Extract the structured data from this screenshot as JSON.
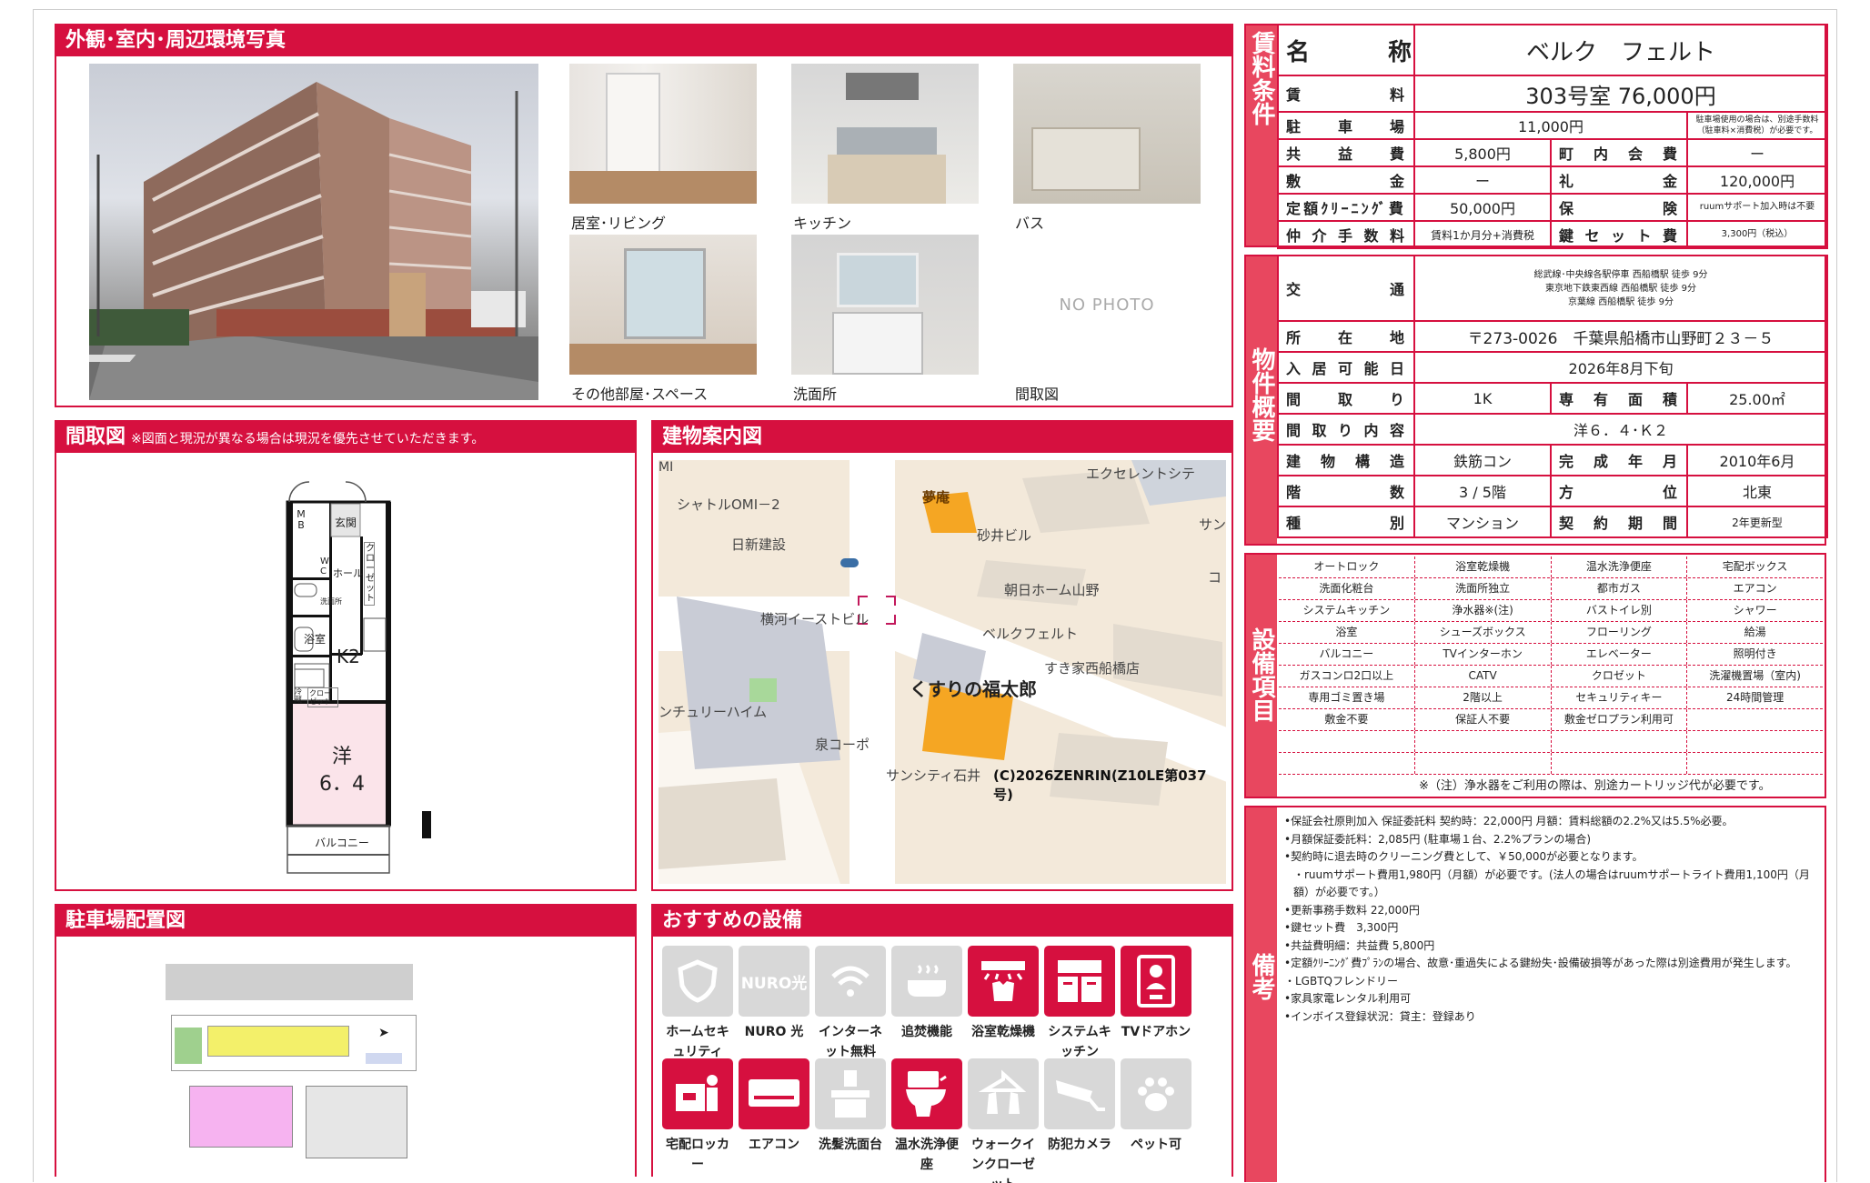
{
  "photos": {
    "title": "外観･室内･周辺環境写真",
    "captions": [
      "居室･リビング",
      "キッチン",
      "バス",
      "その他部屋･スペース",
      "洗面所",
      "間取図"
    ],
    "no_photo": "NO PHOTO"
  },
  "floorplan": {
    "title": "間取図",
    "note": "※図面と現況が異なる場合は現況を優先させていただきます。",
    "labels": {
      "mb": "M B",
      "entrance": "玄関",
      "wc": "W C",
      "hall": "ホール",
      "closet": "クローゼット",
      "washroom": "洗面所",
      "bath": "浴室",
      "kitchen": "K2",
      "closet2": "クローゼット",
      "room": "洋",
      "room_size": "6．4",
      "balcony": "バルコニー",
      "fridge": "冷蔵"
    }
  },
  "map": {
    "title": "建物案内図",
    "labels": [
      "MI",
      "シャトルOMI－2",
      "夢庵",
      "エクセレントシテ",
      "サン",
      "日新建設",
      "砂井ビル",
      "朝日ホーム山野",
      "コ",
      "横河イーストビル",
      "ベルクフェルト",
      "すき家西船橋店",
      "くすりの福太郎",
      "ンチュリーハイム",
      "泉コーポ",
      "サンシティ石井"
    ],
    "copyright": "(C)2026ZENRIN(Z10LE第037号)"
  },
  "parking": {
    "title": "駐車場配置図"
  },
  "recommended": {
    "title": "おすすめの設備",
    "items": [
      {
        "label": "ホームセキュリティ",
        "on": false,
        "icon": "shield-icon"
      },
      {
        "label": "NURO 光",
        "on": false,
        "icon": "nuro-icon",
        "text": "NURO光"
      },
      {
        "label": "インターネット無料",
        "on": false,
        "icon": "wifi-icon"
      },
      {
        "label": "追焚機能",
        "on": false,
        "icon": "bathtub-icon"
      },
      {
        "label": "浴室乾燥機",
        "on": true,
        "icon": "bath-dryer-icon"
      },
      {
        "label": "システムキッチン",
        "on": true,
        "icon": "kitchen-icon"
      },
      {
        "label": "TVドアホン",
        "on": true,
        "icon": "intercom-icon"
      },
      {
        "label": "宅配ロッカー",
        "on": true,
        "icon": "locker-icon"
      },
      {
        "label": "エアコン",
        "on": true,
        "icon": "aircon-icon"
      },
      {
        "label": "洗髪洗面台",
        "on": false,
        "icon": "sink-icon"
      },
      {
        "label": "温水洗浄便座",
        "on": true,
        "icon": "toilet-icon"
      },
      {
        "label": "ウォークインクローゼット",
        "on": false,
        "icon": "closet-icon"
      },
      {
        "label": "防犯カメラ",
        "on": false,
        "icon": "camera-icon"
      },
      {
        "label": "ペット可",
        "on": false,
        "icon": "paw-icon"
      }
    ]
  },
  "rent": {
    "side": "賃料条件",
    "name_label": "名　　　称",
    "name": "ベルク　フェルト",
    "rent_label": "賃　　　料",
    "rent": "303号室 76,000円",
    "parking_label": "駐車場",
    "parking": "11,000円",
    "parking_note": "駐車場使用の場合は、別途手数料（駐車料×消費税）が必要です。",
    "common_label": "共益費",
    "common": "5,800円",
    "town_label": "町内会費",
    "town": "ー",
    "deposit_label": "敷金",
    "deposit": "ー",
    "key_money_label": "礼金",
    "key_money": "120,000円",
    "cleaning_label": "定額ｸﾘｰﾆﾝｸﾞ費",
    "cleaning": "50,000円",
    "insurance_label": "保険",
    "insurance": "ruumサポート加入時は不要",
    "brokerage_label": "仲介手数料",
    "brokerage": "賃料1か月分+消費税",
    "keyset_label": "鍵セット費",
    "keyset": "3,300円（税込）"
  },
  "property": {
    "side": "物件概要",
    "transport_label": "交　通",
    "transport": [
      "総武線･中央線各駅停車 西船橋駅 徒歩 9分",
      "東京地下鉄東西線 西船橋駅 徒歩 9分",
      "京葉線 西船橋駅 徒歩 9分"
    ],
    "address_label": "所在地",
    "address": "〒273-0026　千葉県船橋市山野町２３－５",
    "move_label": "入居可能日",
    "move": "2026年8月下旬",
    "layout_label": "間取り",
    "layout": "1K",
    "area_label": "専有面積",
    "area": "25.00㎡",
    "detail_label": "間取り内容",
    "detail": "洋６．４･Ｋ２",
    "structure_label": "建物構造",
    "structure": "鉄筋コン",
    "built_label": "完成年月",
    "built": "2010年6月",
    "floor_label": "階数",
    "floor": "3 / 5階",
    "direction_label": "方位",
    "direction": "北東",
    "type_label": "種別",
    "type": "マンション",
    "contract_label": "契約期間",
    "contract": "2年更新型"
  },
  "equipment": {
    "side": "設備項目",
    "rows": [
      [
        "オートロック",
        "浴室乾燥機",
        "温水洗浄便座",
        "宅配ボックス"
      ],
      [
        "洗面化粧台",
        "洗面所独立",
        "都市ガス",
        "エアコン"
      ],
      [
        "システムキッチン",
        "浄水器※(注)",
        "バストイレ別",
        "シャワー"
      ],
      [
        "浴室",
        "シューズボックス",
        "フローリング",
        "給湯"
      ],
      [
        "バルコニー",
        "TVインターホン",
        "エレベーター",
        "照明付き"
      ],
      [
        "ガスコンロ2口以上",
        "CATV",
        "クロゼット",
        "洗濯機置場（室内)"
      ],
      [
        "専用ゴミ置き場",
        "2階以上",
        "セキュリティキー",
        "24時間管理"
      ],
      [
        "敷金不要",
        "保証人不要",
        "敷金ゼロプラン利用可",
        ""
      ],
      [
        "",
        "",
        "",
        ""
      ],
      [
        "",
        "",
        "",
        ""
      ]
    ],
    "note": "※（注）浄水器をご利用の際は、別途カートリッジ代が必要です。"
  },
  "remarks": {
    "side": "備考",
    "lines": [
      "•保証会社原則加入 保証委託料 契約時：22,000円 月額：賃料総額の2.2%又は5.5%必要。",
      "•月額保証委託料：2,085円 (駐車場１台、2.2%プランの場合)",
      "•契約時に退去時のクリーニング費として、￥50,000が必要となります。",
      "・ruumサポート費用1,980円（月額）が必要です。(法人の場合はruumサポートライト費用1,100円（月額）が必要です。）",
      "•更新事務手数料 22,000円",
      "•鍵セット費　3,300円",
      "•共益費明細：共益費 5,800円",
      "•定額ｸﾘｰﾆﾝｸﾞ費ﾌﾟﾗﾝの場合、故意･重過失による鍵紛失･設備破損等があった際は別途費用が発生します。",
      "・LGBTQフレンドリー",
      "•家具家電レンタル利用可",
      "•インボイス登録状況：貸主：登録あり"
    ]
  }
}
